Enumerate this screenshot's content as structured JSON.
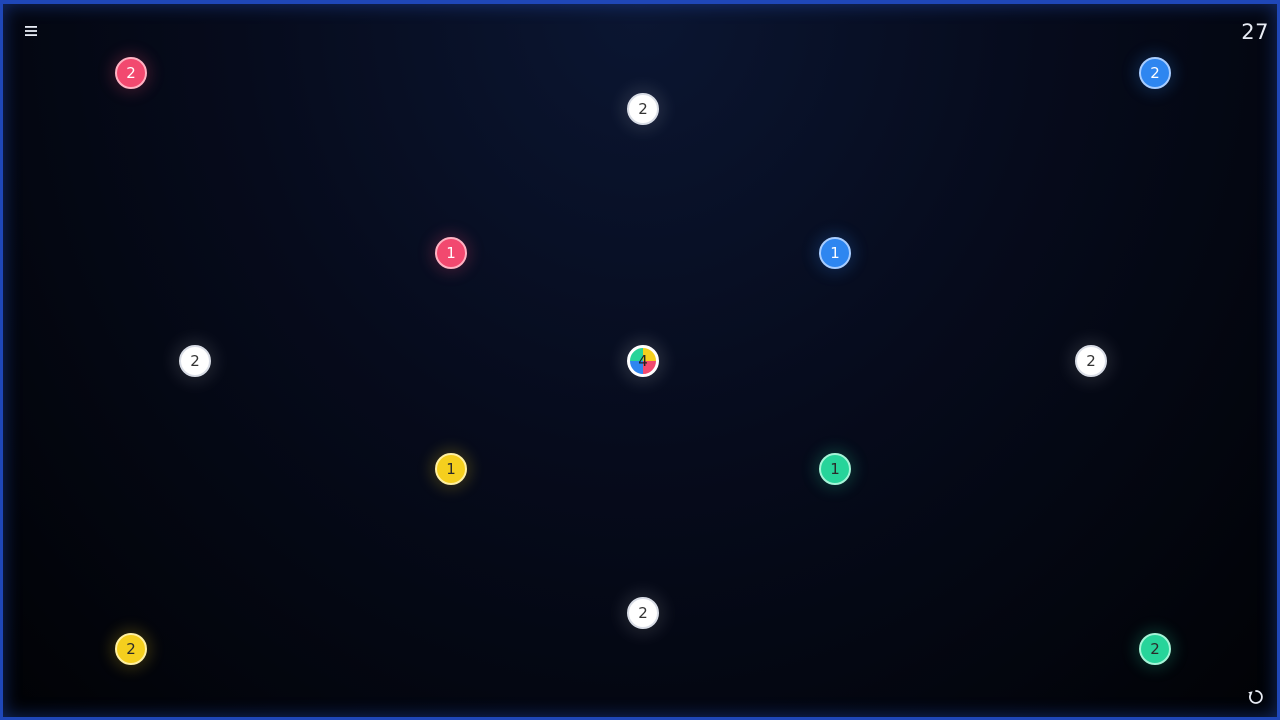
{
  "level": "27",
  "icons": {
    "menu": "menu-icon",
    "restart": "restart-icon"
  },
  "colors": {
    "border": "#1f47b8",
    "red": "#f2496f",
    "blue": "#2e86f0",
    "white": "#ffffff",
    "yellow": "#f5cf1e",
    "green": "#27d49a"
  },
  "nodes": [
    {
      "id": "red-top-left",
      "color": "red",
      "value": "2"
    },
    {
      "id": "white-top",
      "color": "white",
      "value": "2"
    },
    {
      "id": "blue-top-right",
      "color": "blue",
      "value": "2"
    },
    {
      "id": "red-inner",
      "color": "red",
      "value": "1"
    },
    {
      "id": "blue-inner",
      "color": "blue",
      "value": "1"
    },
    {
      "id": "white-left",
      "color": "white",
      "value": "2"
    },
    {
      "id": "multicolor-center",
      "color": "multi",
      "value": "4"
    },
    {
      "id": "white-right",
      "color": "white",
      "value": "2"
    },
    {
      "id": "yellow-inner",
      "color": "yellow",
      "value": "1"
    },
    {
      "id": "green-inner",
      "color": "green",
      "value": "1"
    },
    {
      "id": "white-bottom",
      "color": "white",
      "value": "2"
    },
    {
      "id": "yellow-bottom-left",
      "color": "yellow",
      "value": "2"
    },
    {
      "id": "green-bottom-right",
      "color": "green",
      "value": "2"
    }
  ]
}
